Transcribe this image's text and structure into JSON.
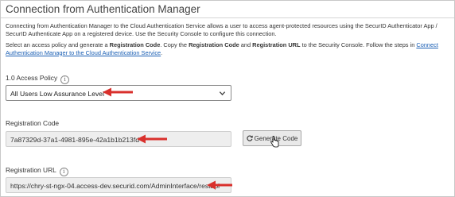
{
  "section": {
    "title": "Connection from Authentication Manager",
    "description": "Connecting from Authentication Manager to the Cloud Authentication Service allows a user to access agent-protected resources using the SecurID Authenticator App / SecurID Authenticate App on a registered device. Use the Security Console to configure this connection.",
    "instructions": {
      "part1": "Select an access policy and generate a ",
      "bold1": "Registration Code",
      "part2": ". Copy the ",
      "bold2": "Registration Code",
      "part3": " and ",
      "bold3": "Registration URL",
      "part4": " to the Security Console. Follow the steps in ",
      "link": "Connect Authentication Manager to the Cloud Authentication Service",
      "part5": "."
    }
  },
  "access_policy": {
    "label": "1.0 Access Policy",
    "info_icon": "info-icon",
    "selected": "All Users Low Assurance Level"
  },
  "registration_code": {
    "label": "Registration Code",
    "value": "7a87329d-37a1-4981-895e-42a1b1b213fd",
    "generate_button": "Generate Code"
  },
  "registration_url": {
    "label": "Registration URL",
    "info_icon": "info-icon",
    "value": "https://chry-st-ngx-04.access-dev.securid.com/AdminInterface/restapi"
  },
  "annotation_color": "#d9302c",
  "link_color": "#1a5fb4"
}
